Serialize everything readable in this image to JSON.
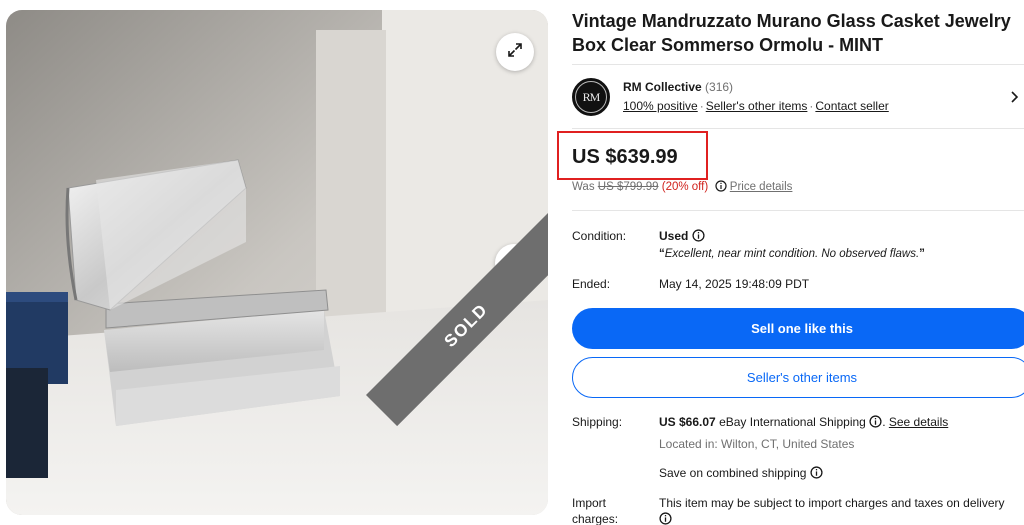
{
  "listing": {
    "title": "Vintage Mandruzzato Murano Glass Casket Jewelry Box Clear Sommerso Ormolu - MINT",
    "sold_badge": "SOLD"
  },
  "seller": {
    "logo_text": "RM",
    "name": "RM Collective",
    "feedback_count": "(316)",
    "positive": "100% positive",
    "other_items_link": "Seller's other items",
    "contact_link": "Contact seller"
  },
  "price": {
    "current": "US $639.99",
    "was_label": "Was",
    "was_price": "US $799.99",
    "discount": "(20% off)",
    "details_link": "Price details"
  },
  "details": {
    "condition_label": "Condition:",
    "condition_value": "Used",
    "condition_note": "Excellent, near mint condition. No observed flaws.",
    "ended_label": "Ended:",
    "ended_value": "May 14, 2025 19:48:09 PDT"
  },
  "buttons": {
    "sell_one": "Sell one like this",
    "sellers_items": "Seller's other items"
  },
  "shipping": {
    "label": "Shipping:",
    "cost": "US $66.07",
    "method": "eBay International Shipping",
    "details_link": "See details",
    "location": "Located in: Wilton, CT, United States",
    "combined": "Save on combined shipping"
  },
  "import": {
    "label_line1": "Import",
    "label_line2": "charges:",
    "text": "This item may be subject to import charges and taxes on delivery"
  },
  "icons": [
    "expand-icon",
    "chevron-right-icon",
    "info-icon"
  ]
}
